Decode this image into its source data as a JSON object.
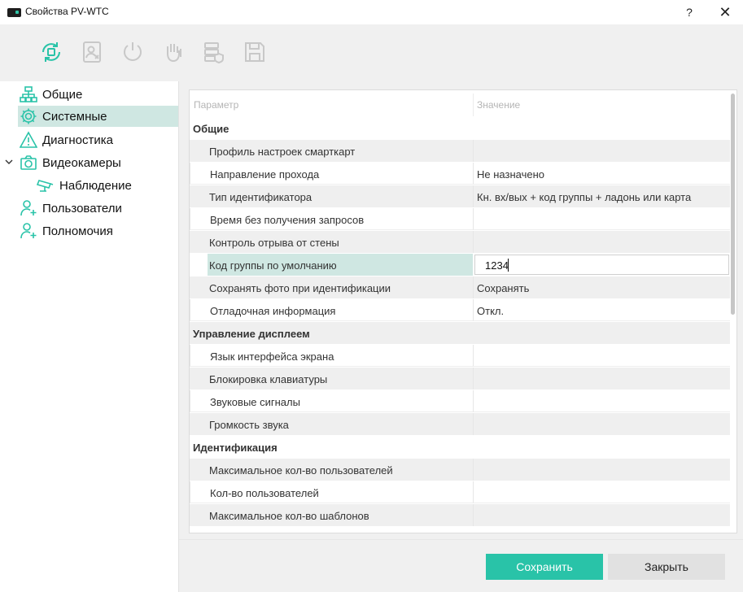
{
  "window": {
    "title": "Свойства PV-WTC",
    "help_label": "?",
    "close_label": "✕"
  },
  "toolbar": {
    "tools": [
      {
        "icon": "sync-chip-icon",
        "active": true
      },
      {
        "icon": "person-card-icon",
        "active": false
      },
      {
        "icon": "power-restart-icon",
        "active": false
      },
      {
        "icon": "hand-palm-icon",
        "active": false
      },
      {
        "icon": "server-shield-icon",
        "active": false
      },
      {
        "icon": "save-disk-icon",
        "active": false
      }
    ],
    "accent_color": "#29c3a8",
    "disabled_color": "#c8c8c8"
  },
  "nav": {
    "items": [
      {
        "label": "Общие",
        "icon": "network-tree-icon"
      },
      {
        "label": "Системные",
        "icon": "gear-icon",
        "selected": true
      },
      {
        "label": "Диагностика",
        "icon": "warning-triangle-icon"
      },
      {
        "label": "Видеокамеры",
        "icon": "camera-icon",
        "expanded": true
      },
      {
        "label": "Наблюдение",
        "icon": "cctv-icon",
        "child": true
      },
      {
        "label": "Пользователи",
        "icon": "user-add-icon"
      },
      {
        "label": "Полномочия",
        "icon": "user-key-icon"
      }
    ]
  },
  "grid": {
    "header": {
      "param": "Параметр",
      "value": "Значение"
    },
    "rows": [
      {
        "type": "category",
        "label": "Общие"
      },
      {
        "type": "item",
        "name": "Профиль настроек смарткарт",
        "value": "",
        "shade": true
      },
      {
        "type": "item",
        "name": "Направление прохода",
        "value": "Не назначено",
        "shade": false
      },
      {
        "type": "item",
        "name": "Тип идентификатора",
        "value": "Кн. вх/вых + код группы + ладонь или карта",
        "shade": true
      },
      {
        "type": "item",
        "name": "Время без получения запросов",
        "value": "",
        "shade": false
      },
      {
        "type": "item",
        "name": "Контроль отрыва от стены",
        "value": "",
        "shade": true
      },
      {
        "type": "item",
        "name": "Код группы по умолчанию",
        "value": "1234",
        "selected": true
      },
      {
        "type": "item",
        "name": "Сохранять фото при идентификации",
        "value": "Сохранять",
        "shade": true
      },
      {
        "type": "item",
        "name": "Отладочная информация",
        "value": "Откл.",
        "shade": false
      },
      {
        "type": "category",
        "label": "Управление дисплеем",
        "shade": true
      },
      {
        "type": "item",
        "name": "Язык интерфейса экрана",
        "value": "",
        "shade": false
      },
      {
        "type": "item",
        "name": "Блокировка клавиатуры",
        "value": "",
        "shade": true
      },
      {
        "type": "item",
        "name": "Звуковые сигналы",
        "value": "",
        "shade": false
      },
      {
        "type": "item",
        "name": "Громкость звука",
        "value": "",
        "shade": true
      },
      {
        "type": "category",
        "label": "Идентификация"
      },
      {
        "type": "item",
        "name": "Максимальное кол-во пользователей",
        "value": "",
        "shade": true
      },
      {
        "type": "item",
        "name": "Кол-во пользователей",
        "value": "",
        "shade": false
      },
      {
        "type": "item",
        "name": "Максимальное кол-во шаблонов",
        "value": "",
        "shade": true
      }
    ]
  },
  "footer": {
    "save_label": "Сохранить",
    "close_label": "Закрыть"
  }
}
